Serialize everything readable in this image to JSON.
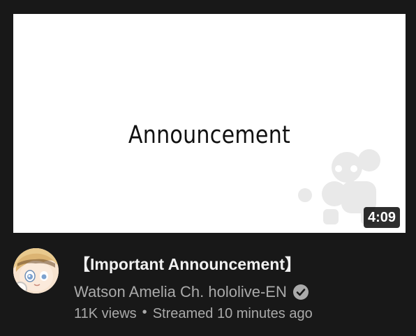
{
  "video": {
    "thumbnail_text": "Announcement",
    "duration": "4:09",
    "title": "【Important Announcement】",
    "channel_name": "Watson Amelia Ch. hololive-EN",
    "verified_icon": "verified-check-icon",
    "views": "11K views",
    "separator": "•",
    "streamed_time": "Streamed 10 minutes ago"
  },
  "colors": {
    "background": "#181818",
    "title": "#f1f1f1",
    "secondary_text": "#aaaaaa",
    "duration_badge": "#000000"
  }
}
